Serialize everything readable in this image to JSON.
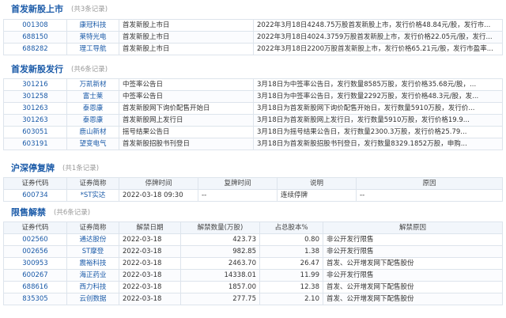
{
  "new_listings": {
    "title": "首发新股上市",
    "count": "(共3条记录)",
    "rows": [
      {
        "code": "001308",
        "name": "康冠科技",
        "event": "首发新股上市日",
        "detail": "2022年3月18日4248.75万股首发新股上市，发行价格48.84元/股，发行市..."
      },
      {
        "code": "688150",
        "name": "莱特光电",
        "event": "首发新股上市日",
        "detail": "2022年3月18日4024.3759万股首发新股上市，发行价格22.05元/股，发行..."
      },
      {
        "code": "688282",
        "name": "理工导航",
        "event": "首发新股上市日",
        "detail": "2022年3月18日2200万股首发新股上市，发行价格65.21元/股，发行市盈率..."
      }
    ]
  },
  "new_issues": {
    "title": "首发新股发行",
    "count": "(共6条记录)",
    "rows": [
      {
        "code": "301216",
        "name": "万凯新材",
        "event": "中签率公告日",
        "detail": "3月18日为中签率公告日，发行数量8585万股，发行价格35.68元/股，..."
      },
      {
        "code": "301258",
        "name": "富士莱",
        "event": "中签率公告日",
        "detail": "3月18日为中签率公告日，发行数量2292万股，发行价格48.3元/股，发..."
      },
      {
        "code": "301263",
        "name": "泰恩康",
        "event": "首发新股网下询价配售开始日",
        "detail": "3月18日为首发新股网下询价配售开始日，发行数量5910万股，发行价..."
      },
      {
        "code": "301263",
        "name": "泰恩康",
        "event": "首发新股网上发行日",
        "detail": "3月18日为首发新股网上发行日，发行数量5910万股，发行价格19.9..."
      },
      {
        "code": "603051",
        "name": "鹿山新材",
        "event": "摇号结果公告日",
        "detail": "3月18日为摇号结果公告日，发行数量2300.3万股，发行价格25.79..."
      },
      {
        "code": "603191",
        "name": "望变电气",
        "event": "首发新股招股书刊登日",
        "detail": "3月18日为首发新股招股书刊登日，发行数量8329.1852万股，申购..."
      }
    ]
  },
  "suspension": {
    "title": "沪深停复牌",
    "count": "(共1条记录)",
    "headers": [
      "证券代码",
      "证券简称",
      "停牌时间",
      "复牌时间",
      "说明",
      "原因"
    ],
    "rows": [
      {
        "code": "600734",
        "name": "*ST实达",
        "halt_time": "2022-03-18 09:30",
        "resume_time": "--",
        "note": "连续停牌",
        "reason": "--"
      }
    ]
  },
  "unlock": {
    "title": "限售解禁",
    "count": "(共6条记录)",
    "headers": [
      "证券代码",
      "证券简称",
      "解禁日期",
      "解禁数量(万股)",
      "占总股本%",
      "解禁原因"
    ],
    "rows": [
      {
        "code": "002560",
        "name": "通达股份",
        "date": "2022-03-18",
        "qty": "423.73",
        "pct": "0.80",
        "reason": "非公开发行限售"
      },
      {
        "code": "002656",
        "name": "ST摩登",
        "date": "2022-03-18",
        "qty": "982.85",
        "pct": "1.38",
        "reason": "非公开发行限售"
      },
      {
        "code": "300953",
        "name": "震裕科技",
        "date": "2022-03-18",
        "qty": "2463.70",
        "pct": "26.47",
        "reason": "首发、公开增发网下配售股份"
      },
      {
        "code": "600267",
        "name": "海正药业",
        "date": "2022-03-18",
        "qty": "14338.01",
        "pct": "11.99",
        "reason": "非公开发行限售"
      },
      {
        "code": "688616",
        "name": "西力科技",
        "date": "2022-03-18",
        "qty": "1857.00",
        "pct": "12.38",
        "reason": "首发、公开增发网下配售股份"
      },
      {
        "code": "835305",
        "name": "云创数据",
        "date": "2022-03-18",
        "qty": "277.75",
        "pct": "2.10",
        "reason": "首发、公开增发网下配售股份"
      }
    ]
  }
}
